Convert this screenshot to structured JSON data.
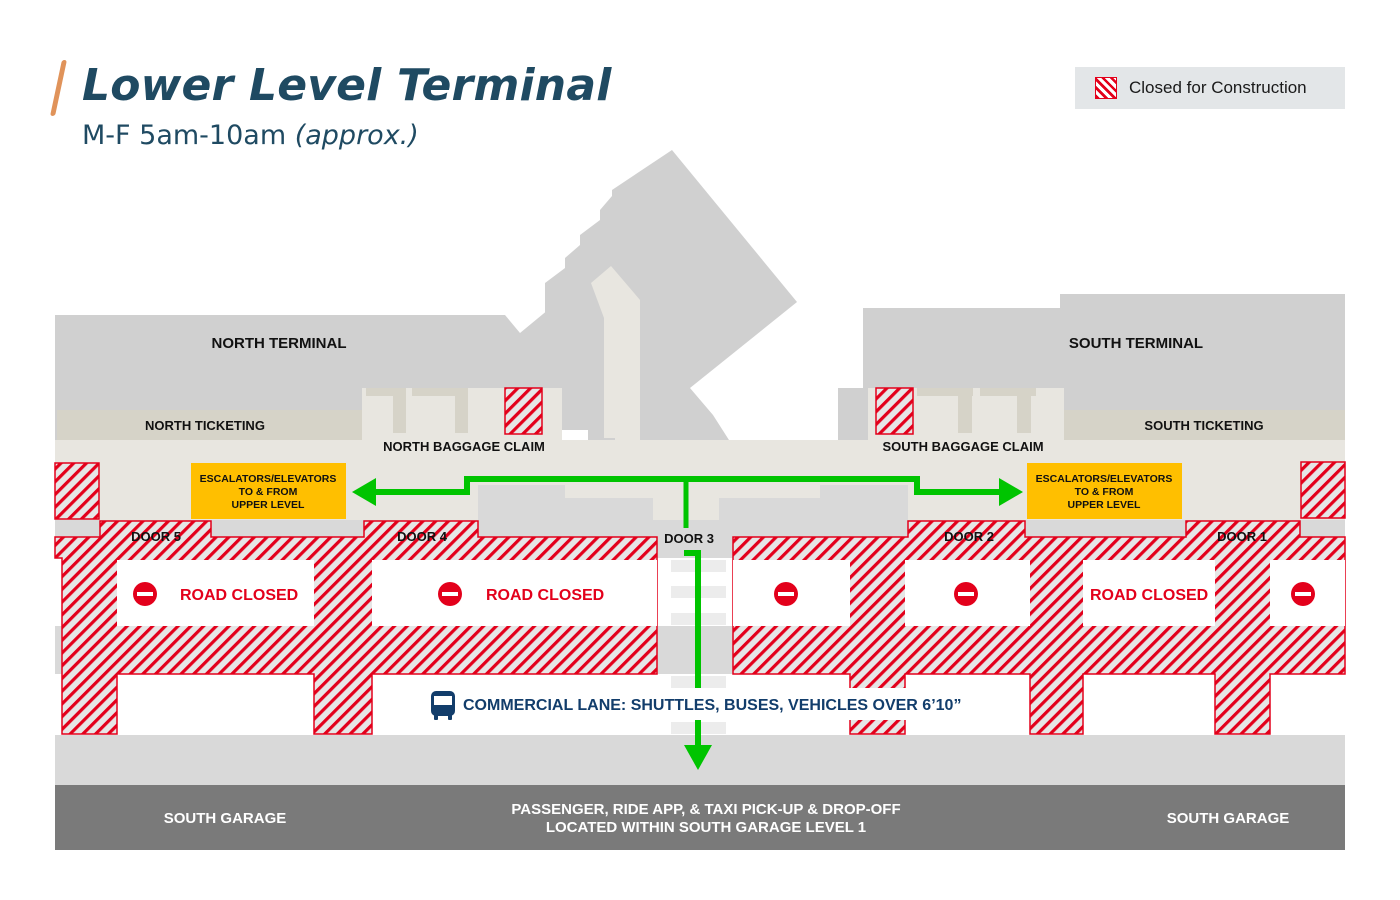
{
  "header": {
    "title": "Lower Level Terminal",
    "subtitle_main": "M-F 5am-10am",
    "subtitle_note": "(approx.)"
  },
  "legend": {
    "label": "Closed for Construction",
    "icon": "hatched-red-square"
  },
  "colors": {
    "title": "#1f4a62",
    "accent_slash": "#e0935a",
    "closed_hatch": "#e3001b",
    "route_arrow": "#00c400",
    "escalator_box": "#ffbf00",
    "building": "#d0d0d0",
    "concourse": "#e8e6e0",
    "ticketing": "#d6d3c8",
    "garage": "#7a7a7a",
    "commercial_text": "#123d6b"
  },
  "map": {
    "terminals": {
      "north": "NORTH TERMINAL",
      "south": "SOUTH TERMINAL"
    },
    "ticketing": {
      "north": "NORTH TICKETING",
      "south": "SOUTH TICKETING"
    },
    "baggage": {
      "north": "NORTH BAGGAGE CLAIM",
      "south": "SOUTH BAGGAGE CLAIM"
    },
    "escalators": {
      "north": [
        "ESCALATORS/ELEVATORS",
        "TO & FROM",
        "UPPER LEVEL"
      ],
      "south": [
        "ESCALATORS/ELEVATORS",
        "TO & FROM",
        "UPPER LEVEL"
      ]
    },
    "doors": [
      "DOOR 5",
      "DOOR 4",
      "DOOR 3",
      "DOOR 2",
      "DOOR 1"
    ],
    "road_closed_label": "ROAD CLOSED",
    "road_closed_icon": "no-entry-icon",
    "commercial_lane": "COMMERCIAL LANE: SHUTTLES, BUSES, VEHICLES OVER 6’10”",
    "commercial_icon": "bus-icon",
    "garage": {
      "left": "SOUTH GARAGE",
      "right": "SOUTH GARAGE",
      "center_line1": "PASSENGER, RIDE APP, & TAXI PICK-UP & DROP-OFF",
      "center_line2": "LOCATED WITHIN SOUTH GARAGE LEVEL 1"
    }
  }
}
